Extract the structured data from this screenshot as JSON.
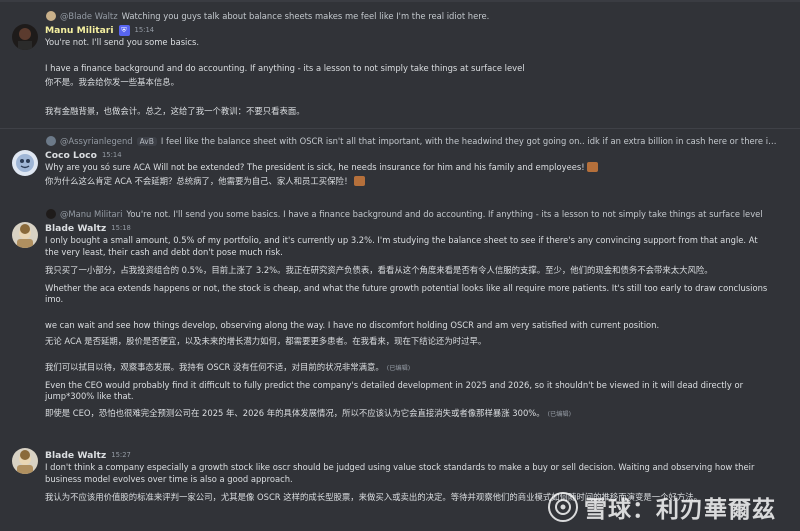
{
  "messages": [
    {
      "reply": {
        "name": "@Blade Waltz",
        "text": "Watching you guys talk about balance sheets makes me feel like I'm the real idiot here."
      },
      "author": "Manu Militari",
      "author_color": "#f5f0a0",
      "badge_icon": "shield-icon",
      "time": "15:14",
      "lines": [
        "You're not. I'll send you some basics.",
        "",
        "I have a finance background and do accounting. If anything - its a lesson to not simply take things at surface level",
        "你不是。我会给你发一些基本信息。",
        "",
        "我有金融背景，也做会计。总之，这给了我一个教训：不要只看表面。"
      ]
    },
    {
      "reply": {
        "name": "@Assyrianlegend",
        "tag": "AvB",
        "text": "I feel like the balance sheet with OSCR isn't all that important, with the headwind they got going on.. idk if an extra billion in cash here or there is going to make a difference with the ..."
      },
      "author": "Coco Loco",
      "author_color": "#dbdee1",
      "time": "15:14",
      "lines": [
        "Why are you só sure ACA Will not be extended? The president is sick, he needs insurance for him and his family and employees!",
        "你为什么这么肯定 ACA 不会延期？总统病了，他需要为自己、家人和员工买保险！"
      ]
    },
    {
      "reply": {
        "name": "@Manu Militari",
        "text": "You're not. I'll send you some basics.  I have a finance background and do accounting. If anything - its a lesson to not simply take things at surface level"
      },
      "author": "Blade Waltz",
      "author_color": "#dbdee1",
      "time": "15:18",
      "paragraphs": [
        {
          "text": "I only bought a small amount, 0.5% of my portfolio, and it's currently up 3.2%. I'm studying the balance sheet to see if there's any convincing support from that angle.  At the very least, their cash and debt don't pose much risk."
        },
        {
          "text": "我只买了一小部分，占我投资组合的 0.5%，目前上涨了 3.2%。我正在研究资产负债表，看看从这个角度来看是否有令人信服的支撑。至少，他们的现金和债务不会带来太大风险。"
        },
        {
          "text": "Whether the aca extends happens or not, the stock is cheap, and what the future growth potential looks like all require more patients. It's still too early to draw conclusions imo."
        },
        {
          "text": "we can wait and see how things develop, observing along the way. I have no discomfort holding OSCR and am very satisfied with current position."
        },
        {
          "text": "无论 ACA 是否延期，股价是否便宜，以及未来的增长潜力如何，都需要更多患者。在我看来，现在下结论还为时过早。"
        },
        {
          "text": "我们可以拭目以待，观察事态发展。我持有 OSCR 没有任何不适，对目前的状况非常满意。",
          "edited": "(已编辑)"
        },
        {
          "text": "Even the CEO would probably find it difficult to fully predict the company's detailed development in 2025 and 2026, so it shouldn't be viewed in it will dead directly or jump*300% like that."
        },
        {
          "text": "即使是 CEO，恐怕也很难完全预测公司在 2025 年、2026 年的具体发展情况，所以不应该认为它会直接消失或者像那样暴涨 300%。",
          "edited": "(已编辑)"
        }
      ]
    },
    {
      "author": "Blade Waltz",
      "author_color": "#dbdee1",
      "time": "15:27",
      "lines": [
        "I don't think a company especially a growth stock like oscr should be judged using value stock standards to make a buy or sell decision. Waiting and observing how their business model evolves over time is also a good approach.",
        "我认为不应该用价值股的标准来评判一家公司，尤其是像 OSCR 这样的成长型股票，来做买入或卖出的决定。等待并观察他们的商业模式如何随时间的推移而演变是一个好方法。"
      ]
    }
  ],
  "watermark": {
    "text": "雪球：利刃華爾茲",
    "logo_icon": "snowball-logo-icon"
  }
}
